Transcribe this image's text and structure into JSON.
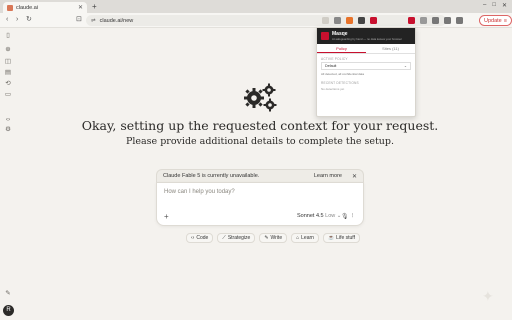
{
  "browser": {
    "tab": {
      "title": "claude.ai"
    },
    "url": "claude.ai/new",
    "update_label": "Update"
  },
  "extension_popup": {
    "title": "Masqe",
    "subtitle": "AI-safeguarding by hand — no data leaves your browser",
    "tabs": [
      "Policy",
      "Sites (11)"
    ],
    "active_policy_label": "ACTIVE POLICY",
    "policy_value": "Default",
    "policy_note": "All detected, all confidential data",
    "recent_label": "RECENT DETECTIONS",
    "recent_empty": "No detections yet"
  },
  "main": {
    "headline": "Okay, setting up the requested context for your request.",
    "subline": "Please provide additional details to complete the setup.",
    "notice_text": "Claude Fable 5 is currently unavailable.",
    "notice_link": "Learn more",
    "input_placeholder": "How can I help you today?",
    "model_name": "Sonnet 4.5",
    "model_mode": "Low",
    "chips": [
      "Code",
      "Strategize",
      "Write",
      "Learn",
      "Life stuff"
    ]
  },
  "sidebar": {
    "avatar_initial": "R"
  },
  "colors": {
    "accent": "#d97757",
    "update_red": "#cc3333",
    "popup_brand": "#c8102e"
  }
}
